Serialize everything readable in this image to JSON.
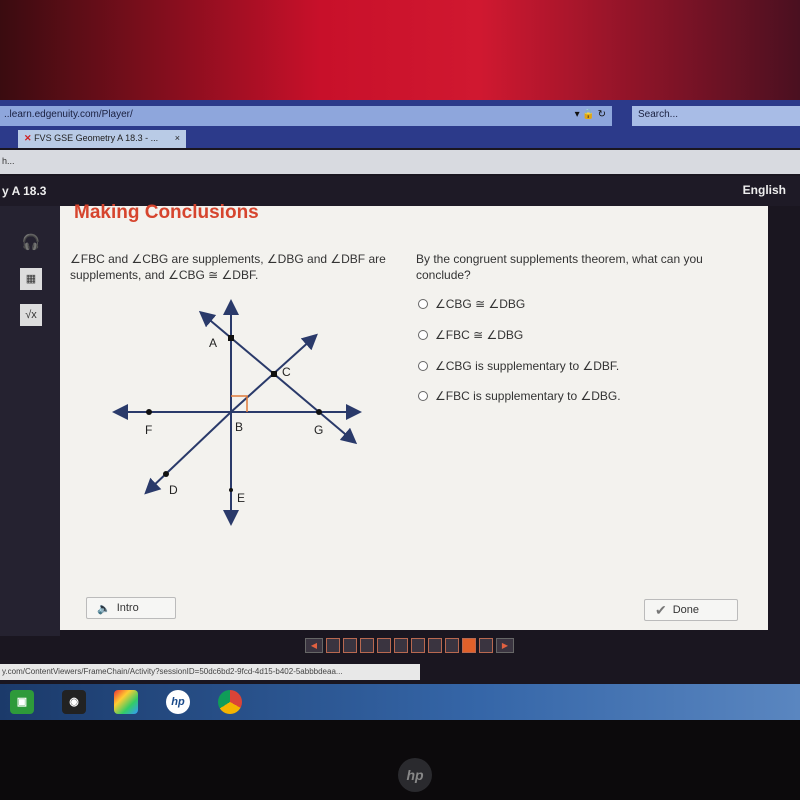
{
  "browser": {
    "url": "..learn.edgenuity.com/Player/",
    "search_placeholder": "Search...",
    "tab_title": "FVS GSE Geometry A 18.3 - ...",
    "tab_close": "×",
    "bookmark_text": "h...",
    "status_url": "y.com/ContentViewers/FrameChain/Activity?sessionID=50dc6bd2-9fcd-4d15-b402-5abbbdeaa..."
  },
  "app": {
    "course_title": "y A 18.3",
    "language": "English",
    "sidebar_icons": [
      "headphones-icon",
      "calculator-icon",
      "square-root-icon"
    ]
  },
  "activity": {
    "title": "Making Conclusions",
    "prompt": "∠FBC and ∠CBG are supplements, ∠DBG and ∠DBF are supplements, and ∠CBG ≅ ∠DBF.",
    "question": "By the congruent supplements theorem, what can you conclude?",
    "options": [
      "∠CBG ≅ ∠DBG",
      "∠FBC ≅ ∠DBG",
      "∠CBG is supplementary to ∠DBF.",
      "∠FBC is supplementary to ∠DBG."
    ],
    "diagram_labels": {
      "A": "A",
      "B": "B",
      "C": "C",
      "D": "D",
      "E": "E",
      "F": "F",
      "G": "G"
    },
    "right_angle_color": "#e07a3a",
    "intro_label": "Intro",
    "done_label": "Done"
  },
  "pager": {
    "total": 10,
    "current": 9,
    "accent": "#e0602a"
  },
  "taskbar": {
    "icons": [
      "store-icon",
      "webcam-icon",
      "photo-app-icon",
      "hp-icon",
      "chrome-icon"
    ],
    "hp_text": "hp"
  },
  "bezel_logo": "hp"
}
